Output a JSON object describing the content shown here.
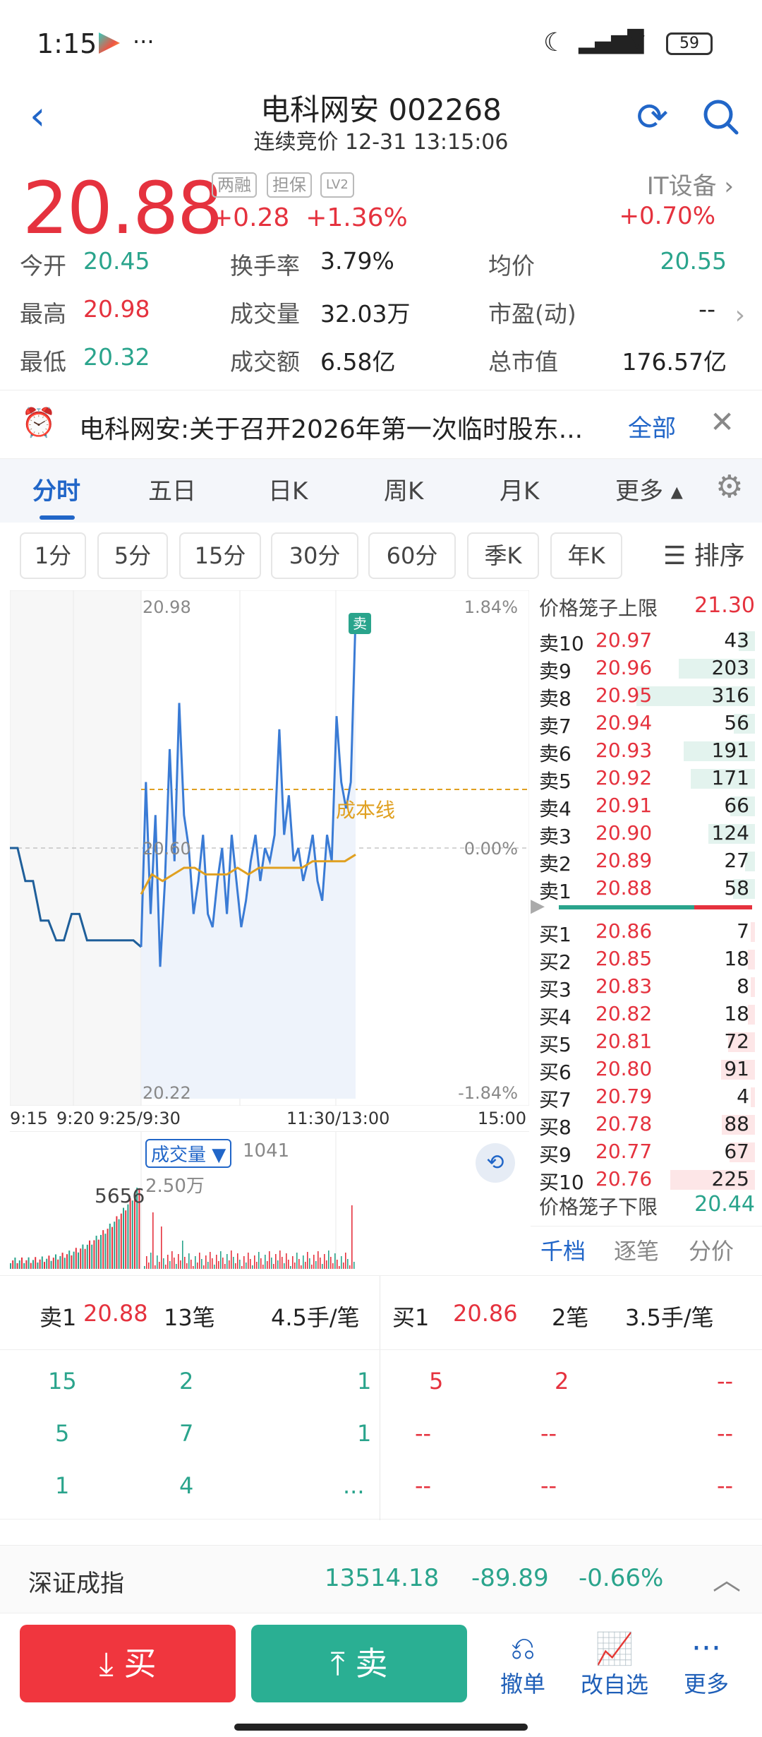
{
  "status": {
    "time": "1:15",
    "battery": "59"
  },
  "header": {
    "title": "电科网安 002268",
    "subtitle": "连续竞价 12-31 13:15:06"
  },
  "quote": {
    "price": "20.88",
    "change": "+0.28",
    "change_pct": "+1.36%",
    "tags": [
      "两融",
      "担保",
      "LV2"
    ],
    "sector": "IT设备",
    "sector_change": "+0.70%",
    "stats": [
      {
        "label": "今开",
        "value": "20.45"
      },
      {
        "label": "换手率",
        "value": "3.79%"
      },
      {
        "label": "均价",
        "value": "20.55"
      },
      {
        "label": "最高",
        "value": "20.98"
      },
      {
        "label": "成交量",
        "value": "32.03万"
      },
      {
        "label": "市盈(动)",
        "value": "--"
      },
      {
        "label": "最低",
        "value": "20.32"
      },
      {
        "label": "成交额",
        "value": "6.58亿"
      },
      {
        "label": "总市值",
        "value": "176.57亿"
      }
    ]
  },
  "notice": {
    "text": "电科网安:关于召开2026年第一次临时股东...",
    "all": "全部"
  },
  "tabs": [
    "分时",
    "五日",
    "日K",
    "周K",
    "月K",
    "更多"
  ],
  "subtabs": [
    "1分",
    "5分",
    "15分",
    "30分",
    "60分",
    "季K",
    "年K"
  ],
  "sort_label": "排序",
  "chart": {
    "price_top": "20.98",
    "price_mid": "20.60",
    "price_bottom": "20.22",
    "pct_top": "1.84%",
    "pct_mid": "0.00%",
    "pct_bottom": "-1.84%",
    "times": [
      "9:15",
      "9:20",
      "9:25/9:30",
      "11:30/13:00",
      "15:00"
    ],
    "cost_label": "成本线",
    "sell_marker": "卖",
    "vol_label": "成交量",
    "vol_value": "1041",
    "vol_max": "2.50万",
    "vol_peak": "5656"
  },
  "chart_data": {
    "type": "line",
    "title": "",
    "xlabel": "",
    "ylabel": "",
    "ylim": [
      20.22,
      20.98
    ],
    "prev_close": 20.6,
    "series": [
      {
        "values": [
          20.6,
          20.6,
          20.55,
          20.55,
          20.49,
          20.49,
          20.46,
          20.46,
          20.5,
          20.5,
          20.46,
          20.46,
          20.46,
          20.46,
          20.46,
          20.46,
          20.46,
          20.45
        ]
      },
      {
        "values": [
          20.45,
          20.7,
          20.5,
          20.65,
          20.42,
          20.55,
          20.75,
          20.58,
          20.82,
          20.65,
          20.6,
          20.5,
          20.55,
          20.62,
          20.5,
          20.48,
          20.55,
          20.6,
          20.5,
          20.62,
          20.55,
          20.48,
          20.52,
          20.58,
          20.62,
          20.55,
          20.6,
          20.58,
          20.62,
          20.78,
          20.62,
          20.68,
          20.58,
          20.6,
          20.55,
          20.58,
          20.62,
          20.55,
          20.52,
          20.62,
          20.58,
          20.8,
          20.7,
          20.66,
          20.7,
          20.95
        ]
      },
      {
        "values": [
          20.53,
          20.56,
          20.55,
          20.56,
          20.57,
          20.57,
          20.56,
          20.56,
          20.56,
          20.57,
          20.56,
          20.57,
          20.57,
          20.57,
          20.57,
          20.57,
          20.58,
          20.58,
          20.58,
          20.58,
          20.59
        ]
      }
    ]
  },
  "book": {
    "upper_label": "价格笼子上限",
    "upper": "21.30",
    "lower_label": "价格笼子下限",
    "lower": "20.44",
    "asks": [
      {
        "label": "卖10",
        "price": "20.97",
        "vol": "43"
      },
      {
        "label": "卖9",
        "price": "20.96",
        "vol": "203"
      },
      {
        "label": "卖8",
        "price": "20.95",
        "vol": "316"
      },
      {
        "label": "卖7",
        "price": "20.94",
        "vol": "56"
      },
      {
        "label": "卖6",
        "price": "20.93",
        "vol": "191"
      },
      {
        "label": "卖5",
        "price": "20.92",
        "vol": "171"
      },
      {
        "label": "卖4",
        "price": "20.91",
        "vol": "66"
      },
      {
        "label": "卖3",
        "price": "20.90",
        "vol": "124"
      },
      {
        "label": "卖2",
        "price": "20.89",
        "vol": "27"
      },
      {
        "label": "卖1",
        "price": "20.88",
        "vol": "58"
      }
    ],
    "bids": [
      {
        "label": "买1",
        "price": "20.86",
        "vol": "7"
      },
      {
        "label": "买2",
        "price": "20.85",
        "vol": "18"
      },
      {
        "label": "买3",
        "price": "20.83",
        "vol": "8"
      },
      {
        "label": "买4",
        "price": "20.82",
        "vol": "18"
      },
      {
        "label": "买5",
        "price": "20.81",
        "vol": "72"
      },
      {
        "label": "买6",
        "price": "20.80",
        "vol": "91"
      },
      {
        "label": "买7",
        "price": "20.79",
        "vol": "4"
      },
      {
        "label": "买8",
        "price": "20.78",
        "vol": "88"
      },
      {
        "label": "买9",
        "price": "20.77",
        "vol": "67"
      },
      {
        "label": "买10",
        "price": "20.76",
        "vol": "225"
      }
    ],
    "footer_tabs": [
      "千档",
      "逐笔",
      "分价"
    ]
  },
  "ticks": {
    "sell_label": "卖1",
    "sell_price": "20.88",
    "sell_count": "13笔",
    "sell_avg": "4.5手/笔",
    "buy_label": "买1",
    "buy_price": "20.86",
    "buy_count": "2笔",
    "buy_avg": "3.5手/笔",
    "left_rows": [
      [
        "15",
        "2",
        "1"
      ],
      [
        "5",
        "7",
        "1"
      ],
      [
        "1",
        "4",
        "..."
      ]
    ],
    "right_rows": [
      [
        "5",
        "2",
        "--"
      ],
      [
        "--",
        "--",
        "--"
      ],
      [
        "--",
        "--",
        "--"
      ]
    ]
  },
  "index": {
    "name": "深证成指",
    "value": "13514.18",
    "change": "-89.89",
    "pct": "-0.66%"
  },
  "bottom": {
    "buy": "买",
    "sell": "卖",
    "cancel": "撤单",
    "watch": "改自选",
    "more": "更多"
  },
  "colors": {
    "red": "#e5323e",
    "green": "#2aa48c",
    "blue": "#2166c8",
    "line": "#3a7bd5",
    "avg": "#e0a020"
  }
}
